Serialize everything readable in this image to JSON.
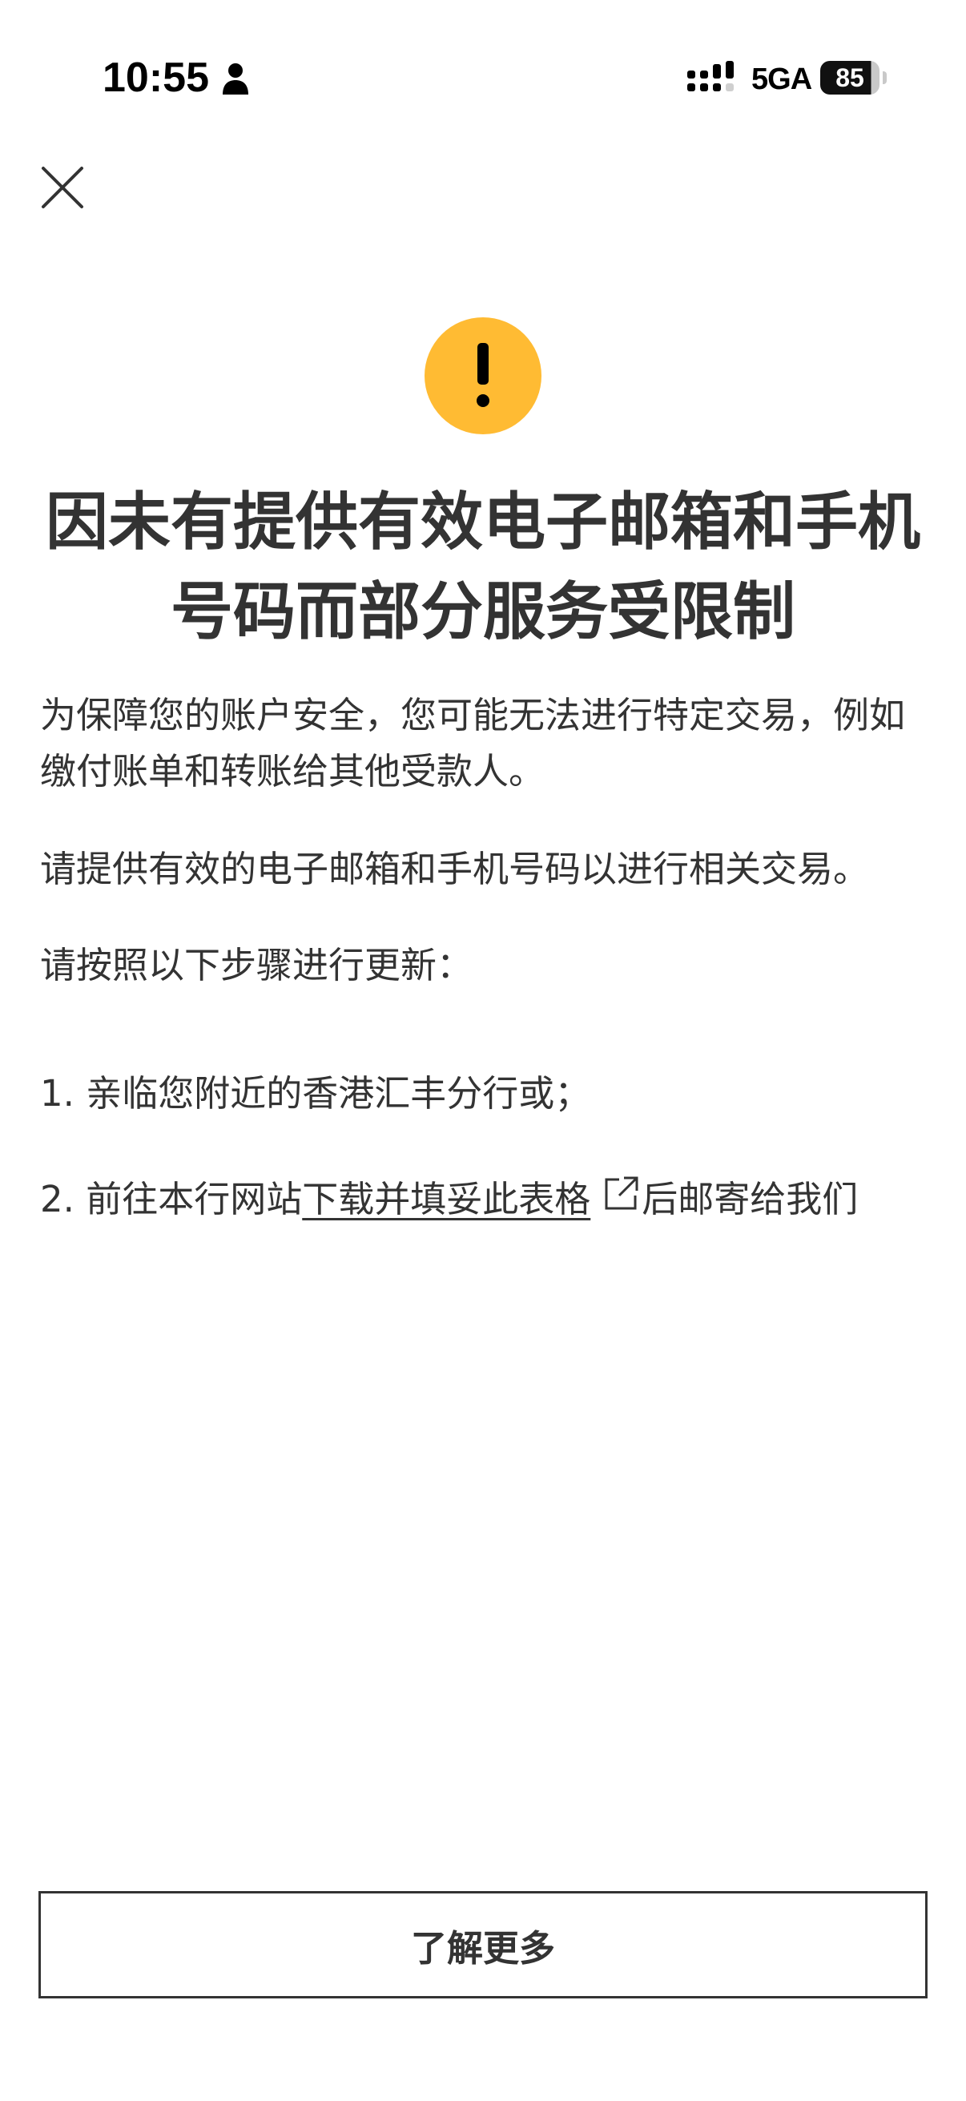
{
  "status_bar": {
    "time": "10:55",
    "network": "5GA",
    "battery": "85",
    "icons": [
      "person-icon",
      "signal-icon",
      "battery-icon"
    ]
  },
  "header": {
    "close_icon": "close-icon"
  },
  "alert": {
    "icon": "warning-icon",
    "icon_color": "#FFBB33",
    "title": "因未有提供有效电子邮箱和手机号码而部分服务受限制",
    "paragraphs": [
      "为保障您的账户安全，您可能无法进行特定交易，例如缴付账单和转账给其他受款人。",
      "请提供有效的电子邮箱和手机号码以进行相关交易。",
      "请按照以下步骤进行更新："
    ],
    "steps": [
      {
        "text": "1. 亲临您附近的香港汇丰分行或；"
      },
      {
        "prefix": "2. 前往本行网站",
        "link": "下载并填妥此表格",
        "link_icon": "external-link-icon",
        "suffix": "后邮寄给我们"
      }
    ]
  },
  "footer": {
    "learn_more_label": "了解更多"
  }
}
